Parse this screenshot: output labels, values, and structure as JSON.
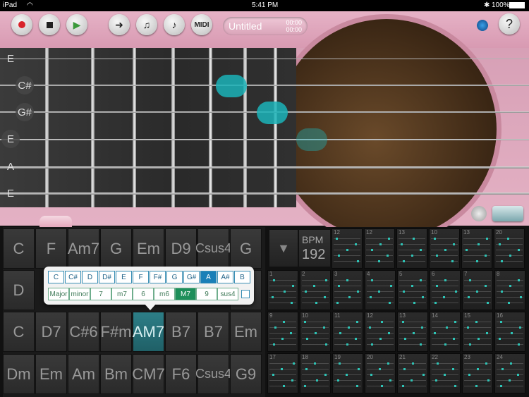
{
  "status": {
    "carrier": "iPad",
    "time": "5:41 PM",
    "battery": "100%"
  },
  "toolbar": {
    "midi_label": "MIDI",
    "song_title": "Untitled",
    "time_a": "00:00",
    "time_b": "00:00",
    "help_label": "?"
  },
  "open_strings": [
    "E",
    "C#",
    "G#",
    "E",
    "A",
    "E"
  ],
  "chord_grid": [
    [
      "C",
      "F",
      "Am7",
      "G",
      "Em",
      "D9",
      "Csus4",
      "G"
    ],
    [
      "D",
      "",
      "",
      "",
      "",
      "",
      "",
      ""
    ],
    [
      "C",
      "D7",
      "C#6",
      "F#m",
      "AM7",
      "B7",
      "B7",
      "Em"
    ],
    [
      "Dm",
      "Em",
      "Am",
      "Bm",
      "CM7",
      "F6",
      "Csus4",
      "G9"
    ]
  ],
  "root_notes": [
    "C",
    "C#",
    "D",
    "D#",
    "E",
    "F",
    "F#",
    "G",
    "G#",
    "A",
    "A#",
    "B"
  ],
  "selected_root": "A",
  "qualities": [
    "Major",
    "minor",
    "7",
    "m7",
    "6",
    "m6",
    "M7",
    "9",
    "sus4"
  ],
  "selected_quality": "M7",
  "bpm_label": "BPM",
  "bpm_value": "192",
  "pattern_numbers": [
    "12",
    "12",
    "13",
    "10",
    "13",
    "20",
    "1",
    "2",
    "3",
    "4",
    "5",
    "6",
    "7",
    "8",
    "9",
    "10",
    "11",
    "12",
    "13",
    "14",
    "15",
    "16",
    "17",
    "18",
    "19",
    "20",
    "21",
    "22",
    "23",
    "24"
  ],
  "colors": {
    "accent": "#1bb3b8",
    "body": "#dba6bb",
    "selected_root": "#1a7fb7",
    "selected_quality": "#1d8f5a"
  }
}
